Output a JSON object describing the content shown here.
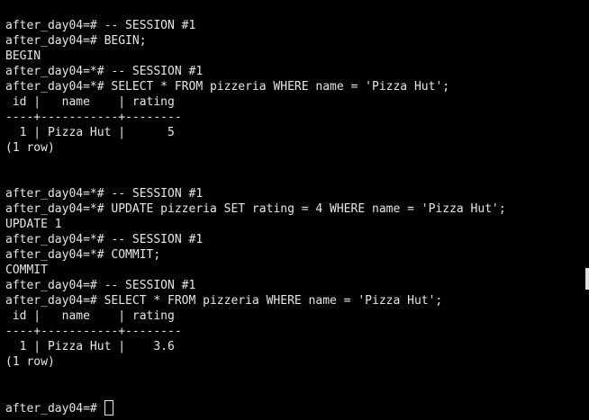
{
  "terminal": {
    "lines": [
      "after_day04=# -- SESSION #1",
      "after_day04=# BEGIN;",
      "BEGIN",
      "after_day04=*# -- SESSION #1",
      "after_day04=*# SELECT * FROM pizzeria WHERE name = 'Pizza Hut';",
      " id |   name    | rating",
      "----+-----------+--------",
      "  1 | Pizza Hut |      5",
      "(1 row)",
      "",
      "",
      "after_day04=*# -- SESSION #1",
      "after_day04=*# UPDATE pizzeria SET rating = 4 WHERE name = 'Pizza Hut';",
      "UPDATE 1",
      "after_day04=*# -- SESSION #1",
      "after_day04=*# COMMIT;",
      "COMMIT",
      "after_day04=# -- SESSION #1",
      "after_day04=# SELECT * FROM pizzeria WHERE name = 'Pizza Hut';",
      " id |   name    | rating",
      "----+-----------+--------",
      "  1 | Pizza Hut |    3.6",
      "(1 row)",
      "",
      "",
      "after_day04=# "
    ]
  },
  "colors": {
    "background": "#000000",
    "text": "#e6e6e6"
  }
}
